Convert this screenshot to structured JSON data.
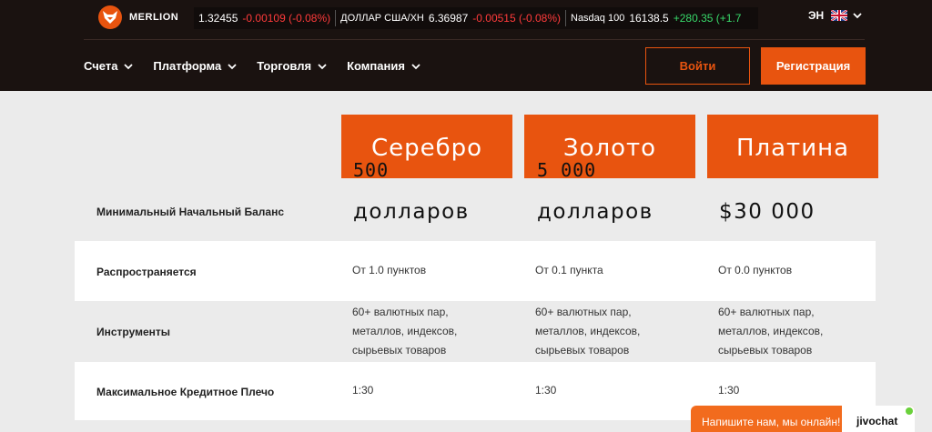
{
  "brand": {
    "name": "MERLION"
  },
  "ticker": [
    {
      "name": "",
      "value": "1.32455",
      "change": "-0.00109 (-0.08%)",
      "dir": "neg"
    },
    {
      "name": "ДОЛЛАР США/ХН",
      "value": "6.36987",
      "change": "-0.00515 (-0.08%)",
      "dir": "neg"
    },
    {
      "name": "Nasdaq 100",
      "value": "16138.5",
      "change": "+280.35 (+1.7",
      "dir": "pos"
    }
  ],
  "language": {
    "label": "ЭН"
  },
  "nav": [
    {
      "label": "Счета"
    },
    {
      "label": "Платформа"
    },
    {
      "label": "Торговля"
    },
    {
      "label": "Компания"
    }
  ],
  "auth": {
    "login": "Войти",
    "register": "Регистрация"
  },
  "plans": [
    {
      "name": "Серебро",
      "amount_overlay": "500",
      "balance": "долларов"
    },
    {
      "name": "Золото",
      "amount_overlay": "5 000",
      "balance": "долларов"
    },
    {
      "name": "Платина",
      "amount_overlay": "",
      "balance": "$30 000"
    }
  ],
  "rows": {
    "balance_label": "Минимальный Начальный Баланс",
    "spread_label": "Распространяется",
    "spread": [
      "От 1.0 пунктов",
      "От 0.1 пункта",
      "От 0.0 пунктов"
    ],
    "instruments_label": "Инструменты",
    "instruments": [
      [
        "60+ валютных пар,",
        "металлов, индексов,",
        "сырьевых товаров"
      ],
      [
        "60+ валютных пар,",
        "металлов, индексов,",
        "сырьевых товаров"
      ],
      [
        "60+ валютных пар,",
        "металлов, индексов,",
        "сырьевых товаров"
      ]
    ],
    "leverage_label": "Максимальное Кредитное Плечо",
    "leverage": [
      "1:30",
      "1:30",
      "1:30"
    ]
  },
  "chat": {
    "text": "Напишите нам, мы онлайн!",
    "logo": "jivochat"
  },
  "colors": {
    "accent": "#e8540f",
    "header_bg": "#1a1210",
    "negative": "#ff3b3b",
    "positive": "#38d96a"
  }
}
